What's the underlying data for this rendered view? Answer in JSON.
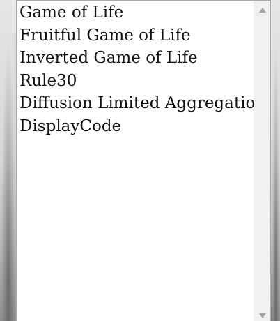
{
  "listbox": {
    "options": [
      "Game of Life",
      "Fruitful Game of Life",
      "Inverted Game of Life",
      "Rule30",
      "Diffusion Limited Aggregation",
      "DisplayCode"
    ]
  },
  "scrollbar": {
    "up_icon": "triangle-up-icon",
    "down_icon": "triangle-down-icon"
  },
  "colors": {
    "list_background": "#ffffff",
    "text": "#111111",
    "scrollbar_track": "#f1f1f1",
    "arrow": "#a3a3a3"
  }
}
